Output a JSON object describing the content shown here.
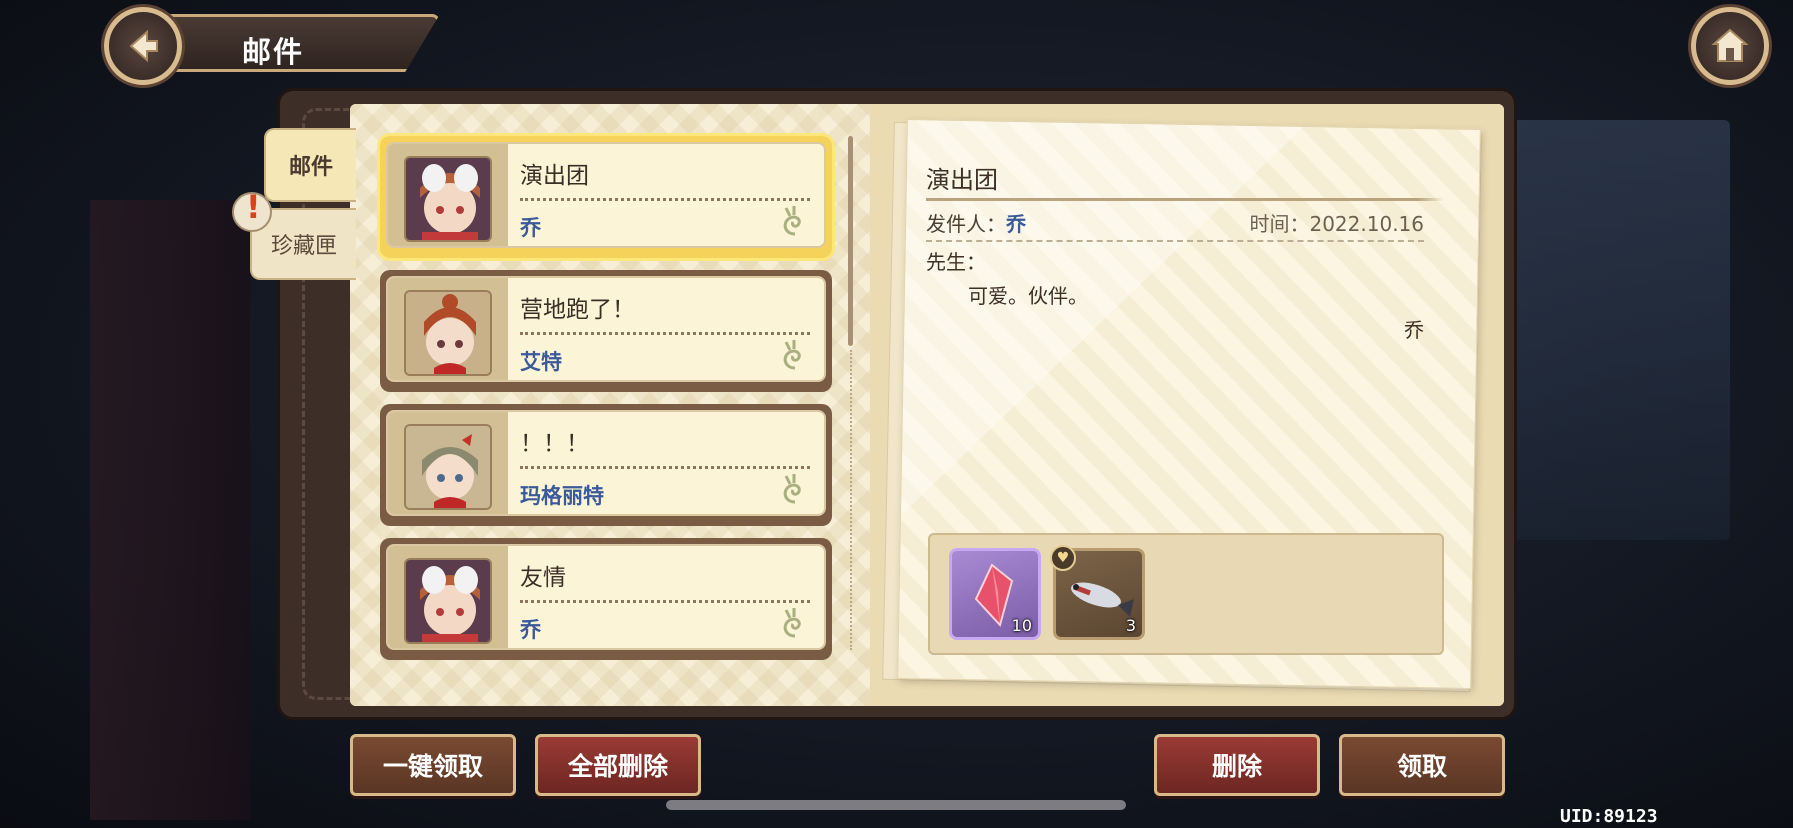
{
  "header": {
    "title": "邮件"
  },
  "tabs": [
    {
      "label": "邮件",
      "active": true
    },
    {
      "label": "珍藏匣",
      "active": false,
      "alert": "!"
    }
  ],
  "mail_list": [
    {
      "subject": "演出团",
      "sender": "乔",
      "selected": true
    },
    {
      "subject": "营地跑了！",
      "sender": "艾特",
      "selected": false
    },
    {
      "subject": "！！！",
      "sender": "玛格丽特",
      "selected": false
    },
    {
      "subject": "友情",
      "sender": "乔",
      "selected": false
    }
  ],
  "letter": {
    "title": "演出团",
    "sender_label": "发件人：",
    "sender_name": "乔",
    "time": "时间：2022.10.16",
    "greeting": "先生：",
    "body": "可爱。伙伴。",
    "signature": "乔"
  },
  "attachments": [
    {
      "name": "gem",
      "count": "10"
    },
    {
      "name": "fish",
      "count": "3"
    }
  ],
  "buttons": {
    "claim_all": "一键领取",
    "delete_all": "全部删除",
    "delete": "删除",
    "claim": "领取"
  },
  "uid": "UID:89123",
  "colors": {
    "selected_border": "#f5d35a",
    "sender_blue": "#3b5a9a",
    "button_red": "#9a3b34",
    "gem_frame": "#c7a8f2"
  }
}
